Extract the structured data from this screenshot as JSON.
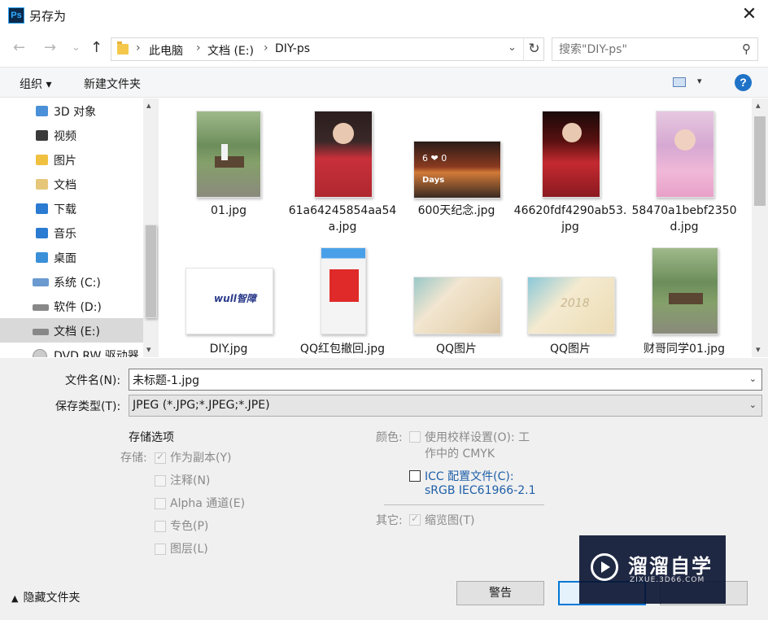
{
  "window": {
    "title": "另存为",
    "app_badge": "Ps",
    "close_glyph": "✕"
  },
  "nav": {
    "back_glyph": "←",
    "forward_glyph": "→",
    "recent_glyph": "⌄",
    "up_glyph": "↑",
    "breadcrumb": [
      "此电脑",
      "文档 (E:)",
      "DIY-ps"
    ],
    "crumb_sep": "›",
    "dropdown_glyph": "⌄",
    "refresh_glyph": "↻",
    "search_placeholder": "搜索\"DIY-ps\"",
    "search_glyph": "⚲"
  },
  "toolbar": {
    "organize": "组织 ▾",
    "new_folder": "新建文件夹",
    "view_dd": "▾",
    "help": "?"
  },
  "sidebar": {
    "up_arrow": "▴",
    "down_arrow": "▾",
    "items": [
      {
        "label": "3D 对象",
        "icon": "3d-objects-icon",
        "color": "#4a90d9"
      },
      {
        "label": "视频",
        "icon": "video-icon",
        "color": "#3a3a3a"
      },
      {
        "label": "图片",
        "icon": "pictures-icon",
        "color": "#f0c040"
      },
      {
        "label": "文档",
        "icon": "documents-icon",
        "color": "#e6c77a"
      },
      {
        "label": "下载",
        "icon": "downloads-icon",
        "color": "#2a7bd1"
      },
      {
        "label": "音乐",
        "icon": "music-icon",
        "color": "#2a7bd1"
      },
      {
        "label": "桌面",
        "icon": "desktop-icon",
        "color": "#3b8fd9"
      },
      {
        "label": "系统 (C:)",
        "icon": "system-drive-icon",
        "color": "#6a9ad0"
      },
      {
        "label": "软件 (D:)",
        "icon": "drive-icon",
        "color": "#888888"
      },
      {
        "label": "文档 (E:)",
        "icon": "drive-icon",
        "color": "#888888"
      },
      {
        "label": "DVD RW 驱动器",
        "icon": "dvd-drive-icon",
        "color": "#999999"
      }
    ]
  },
  "files": [
    {
      "name": "01.jpg"
    },
    {
      "name": "61a64245854aa54a.jpg"
    },
    {
      "name": "600天纪念.jpg"
    },
    {
      "name": "46620fdf4290ab53.jpg"
    },
    {
      "name": "58470a1bebf2350d.jpg"
    },
    {
      "name": "DIY.jpg"
    },
    {
      "name": "QQ红包撤回.jpg"
    },
    {
      "name": "QQ图片"
    },
    {
      "name": "QQ图片"
    },
    {
      "name": "财哥同学01.jpg"
    }
  ],
  "thumb_text": {
    "wull": "wull智障",
    "days": "Days",
    "num": "6 ❤ 0",
    "year": "2018"
  },
  "form": {
    "filename_label": "文件名(N):",
    "filename_value": "未标题-1.jpg",
    "type_label": "保存类型(T):",
    "type_value": "JPEG (*.JPG;*.JPEG;*.JPE)",
    "dd_glyph": "⌄"
  },
  "options": {
    "title": "存储选项",
    "store_label": "存储:",
    "as_copy": "作为副本(Y)",
    "notes": "注释(N)",
    "alpha": "Alpha 通道(E)",
    "spot": "专色(P)",
    "layers": "图层(L)",
    "color_label": "颜色:",
    "proof_line1": "使用校样设置(O): 工",
    "proof_line2": "作中的 CMYK",
    "icc_line1": "ICC 配置文件(C):",
    "icc_line2": "sRGB IEC61966-2.1",
    "other_label": "其它:",
    "thumbnail": "缩览图(T)"
  },
  "footer": {
    "hide_folders": "隐藏文件夹",
    "chevron": "▲",
    "warn_button": "警告"
  },
  "watermark": {
    "main": "溜溜自学",
    "sub": "ZIXUE.3D66.COM"
  }
}
